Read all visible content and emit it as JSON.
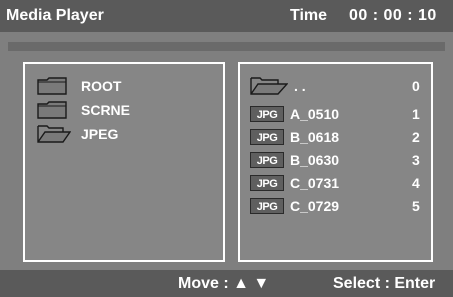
{
  "header": {
    "title": "Media Player",
    "time_label": "Time",
    "time_value": "00 : 00 : 10"
  },
  "left_panel": {
    "items": [
      {
        "label": "ROOT",
        "icon": "folder-closed-icon"
      },
      {
        "label": "SCRNE",
        "icon": "folder-closed-icon"
      },
      {
        "label": "JPEG",
        "icon": "folder-open-icon"
      }
    ]
  },
  "right_panel": {
    "items": [
      {
        "icon_text": "",
        "label": ". .",
        "index": "0",
        "icon": "folder-open-icon"
      },
      {
        "icon_text": "JPG",
        "label": "A_0510",
        "index": "1",
        "icon": "jpg-file-icon"
      },
      {
        "icon_text": "JPG",
        "label": "B_0618",
        "index": "2",
        "icon": "jpg-file-icon"
      },
      {
        "icon_text": "JPG",
        "label": "B_0630",
        "index": "3",
        "icon": "jpg-file-icon"
      },
      {
        "icon_text": "JPG",
        "label": "C_0731",
        "index": "4",
        "icon": "jpg-file-icon"
      },
      {
        "icon_text": "JPG",
        "label": "C_0729",
        "index": "5",
        "icon": "jpg-file-icon"
      }
    ]
  },
  "footer": {
    "move_label": "Move : ▲ ▼",
    "select_label": "Select : Enter"
  },
  "colors": {
    "background": "#7f7f7f",
    "bar": "#5a5a5a",
    "panel": "#868686",
    "text": "#ffffff"
  }
}
